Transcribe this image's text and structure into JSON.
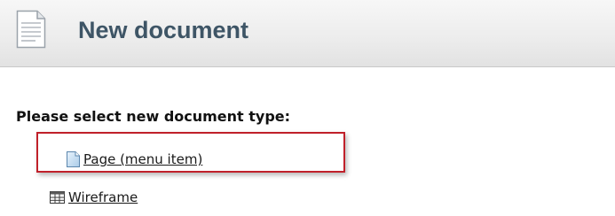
{
  "header": {
    "title": "New document",
    "icon": "document-icon"
  },
  "prompt": "Please select new document type:",
  "options": [
    {
      "label": "Page (menu item)",
      "icon": "page-icon",
      "highlighted": true
    },
    {
      "label": "Wireframe",
      "icon": "table-grid-icon",
      "highlighted": false
    }
  ],
  "colors": {
    "title": "#3e5566",
    "highlight_border": "#c0202a"
  }
}
